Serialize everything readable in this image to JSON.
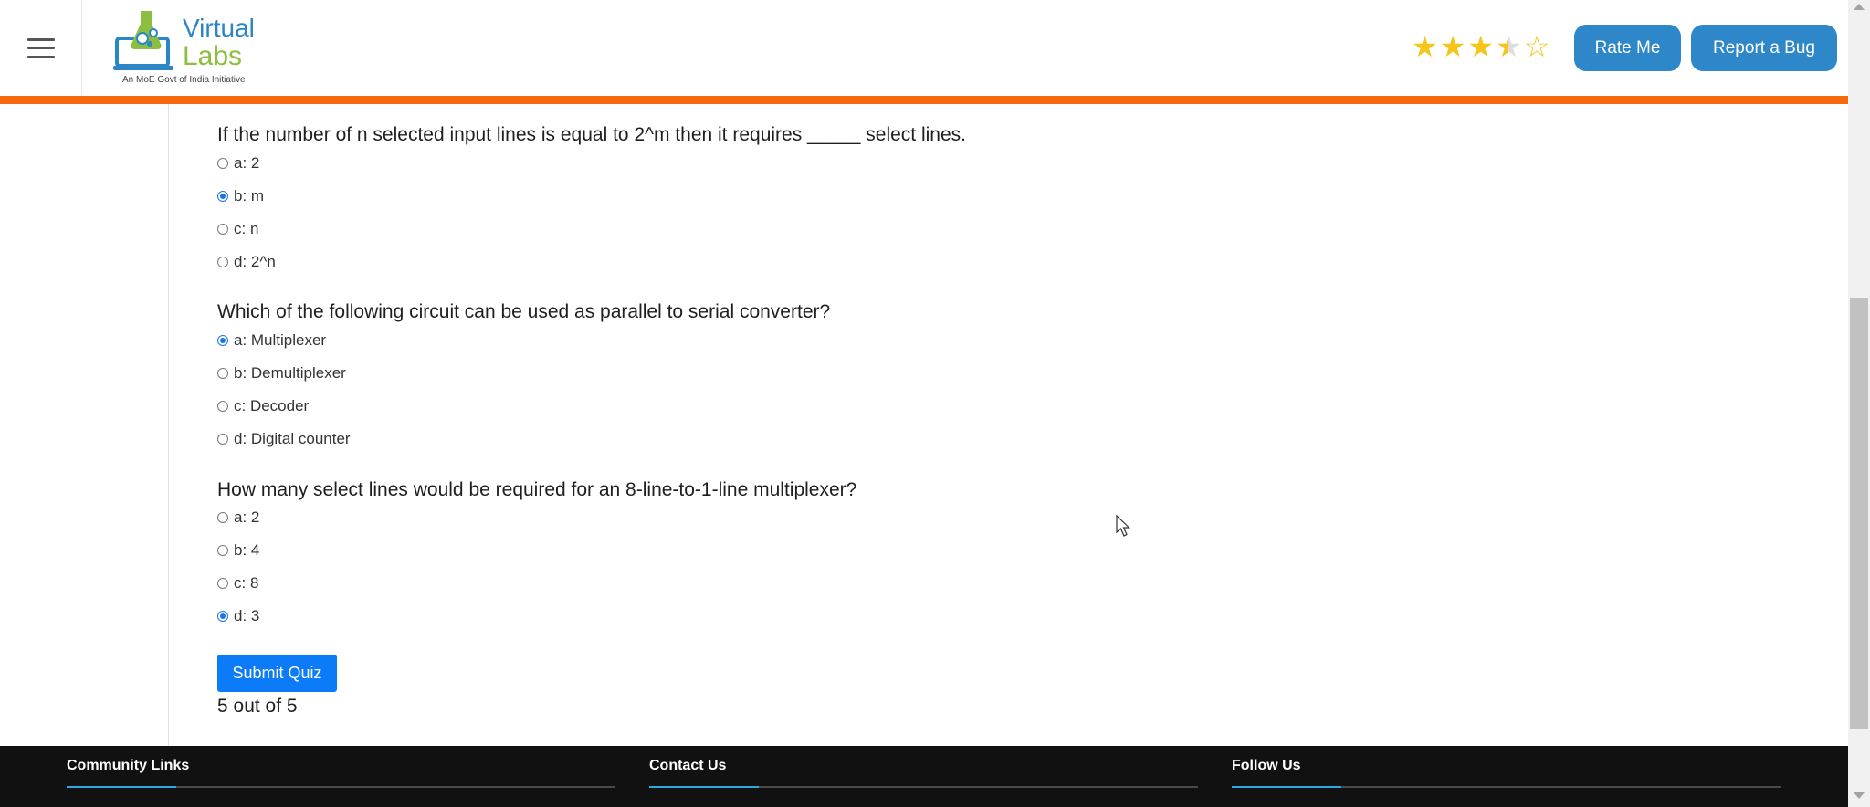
{
  "header": {
    "logo": {
      "word1": "Virtual",
      "word2": "Labs",
      "tagline": "An MoE Govt of India Initiative"
    },
    "rating": {
      "value": 3.5,
      "max": 5
    },
    "rate_button": "Rate Me",
    "bug_button": "Report a Bug"
  },
  "quiz": {
    "questions": [
      {
        "text": "If the number of n selected input lines is equal to 2^m then it requires _____ select lines.",
        "options": [
          {
            "label": "a: 2",
            "checked": false
          },
          {
            "label": "b: m",
            "checked": true
          },
          {
            "label": "c: n",
            "checked": false
          },
          {
            "label": "d: 2^n",
            "checked": false
          }
        ]
      },
      {
        "text": "Which of the following circuit can be used as parallel to serial converter?",
        "options": [
          {
            "label": "a: Multiplexer",
            "checked": true
          },
          {
            "label": "b: Demultiplexer",
            "checked": false
          },
          {
            "label": "c: Decoder",
            "checked": false
          },
          {
            "label": "d: Digital counter",
            "checked": false
          }
        ]
      },
      {
        "text": "How many select lines would be required for an 8-line-to-1-line multiplexer?",
        "options": [
          {
            "label": "a: 2",
            "checked": false
          },
          {
            "label": "b: 4",
            "checked": false
          },
          {
            "label": "c: 8",
            "checked": false
          },
          {
            "label": "d: 3",
            "checked": true
          }
        ]
      }
    ],
    "submit_label": "Submit Quiz",
    "score": "5 out of 5"
  },
  "footer": {
    "columns": [
      "Community Links",
      "Contact Us",
      "Follow Us"
    ]
  },
  "colors": {
    "accent_orange": "#f56a0c",
    "header_button": "#2d87c9",
    "submit_button": "#0b7bf7",
    "footer_bg": "#111111",
    "footer_accent": "#2fa8e0",
    "star": "#f5c518"
  }
}
